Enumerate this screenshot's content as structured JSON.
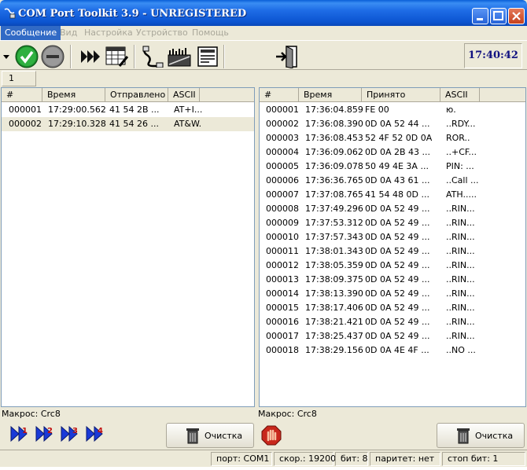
{
  "window": {
    "title": "COM Port Toolkit 3.9 - UNREGISTERED"
  },
  "menu": {
    "items": [
      {
        "label": "Сообщение",
        "active": true
      },
      {
        "label": "Вид"
      },
      {
        "label": "Настройка"
      },
      {
        "label": "Устройство"
      },
      {
        "label": "Помощь"
      }
    ]
  },
  "toolbar": {
    "icons": [
      "dropdown-arrow-icon",
      "connect-check-icon",
      "disconnect-icon",
      "fast-forward-icon",
      "table-edit-icon",
      "cable-icon",
      "settings-device-icon",
      "terminal-icon",
      "exit-door-icon"
    ],
    "clock": "17:40:42"
  },
  "tabs": {
    "active_tab": "1"
  },
  "left": {
    "headers": [
      "#",
      "Время",
      "Отправлено",
      "ASCII"
    ],
    "rows": [
      {
        "id": "000001",
        "time": "17:29:00.562",
        "hex": "41 54 2B ...",
        "ascii": "AT+I..."
      },
      {
        "id": "000002",
        "time": "17:29:10.328",
        "hex": "41 54 26 ...",
        "ascii": "AT&W."
      }
    ],
    "macro": "Макрос: Crc8",
    "clear_label": "Очистка"
  },
  "right": {
    "headers": [
      "#",
      "Время",
      "Принято",
      "ASCII"
    ],
    "rows": [
      {
        "id": "000001",
        "time": "17:36:04.859",
        "hex": "FE 00",
        "ascii": "ю."
      },
      {
        "id": "000002",
        "time": "17:36:08.390",
        "hex": "0D 0A 52 44 ...",
        "ascii": "..RDY..."
      },
      {
        "id": "000003",
        "time": "17:36:08.453",
        "hex": "52 4F 52 0D 0A",
        "ascii": "ROR.."
      },
      {
        "id": "000004",
        "time": "17:36:09.062",
        "hex": "0D 0A 2B 43 ...",
        "ascii": "..+CF..."
      },
      {
        "id": "000005",
        "time": "17:36:09.078",
        "hex": "50 49 4E 3A ...",
        "ascii": "PIN: ..."
      },
      {
        "id": "000006",
        "time": "17:36:36.765",
        "hex": "0D 0A 43 61 ...",
        "ascii": "..Call ..."
      },
      {
        "id": "000007",
        "time": "17:37:08.765",
        "hex": "41 54 48 0D ...",
        "ascii": "ATH....."
      },
      {
        "id": "000008",
        "time": "17:37:49.296",
        "hex": "0D 0A 52 49 ...",
        "ascii": "..RIN..."
      },
      {
        "id": "000009",
        "time": "17:37:53.312",
        "hex": "0D 0A 52 49 ...",
        "ascii": "..RIN..."
      },
      {
        "id": "000010",
        "time": "17:37:57.343",
        "hex": "0D 0A 52 49 ...",
        "ascii": "..RIN..."
      },
      {
        "id": "000011",
        "time": "17:38:01.343",
        "hex": "0D 0A 52 49 ...",
        "ascii": "..RIN..."
      },
      {
        "id": "000012",
        "time": "17:38:05.359",
        "hex": "0D 0A 52 49 ...",
        "ascii": "..RIN..."
      },
      {
        "id": "000013",
        "time": "17:38:09.375",
        "hex": "0D 0A 52 49 ...",
        "ascii": "..RIN..."
      },
      {
        "id": "000014",
        "time": "17:38:13.390",
        "hex": "0D 0A 52 49 ...",
        "ascii": "..RIN..."
      },
      {
        "id": "000015",
        "time": "17:38:17.406",
        "hex": "0D 0A 52 49 ...",
        "ascii": "..RIN..."
      },
      {
        "id": "000016",
        "time": "17:38:21.421",
        "hex": "0D 0A 52 49 ...",
        "ascii": "..RIN..."
      },
      {
        "id": "000017",
        "time": "17:38:25.437",
        "hex": "0D 0A 52 49 ...",
        "ascii": "..RIN..."
      },
      {
        "id": "000018",
        "time": "17:38:29.156",
        "hex": "0D 0A 4E 4F ...",
        "ascii": "..NO ..."
      }
    ],
    "macro": "Макрос: Crc8",
    "clear_label": "Очистка"
  },
  "macros": {
    "icons": [
      "macro-1-icon",
      "macro-2-icon",
      "macro-3-icon",
      "macro-4-icon"
    ]
  },
  "status": {
    "port": "порт: COM1",
    "speed": "скор.: 19200",
    "bits": "бит: 8",
    "parity": "паритет: нет",
    "stop_bits": "стоп бит: 1"
  }
}
